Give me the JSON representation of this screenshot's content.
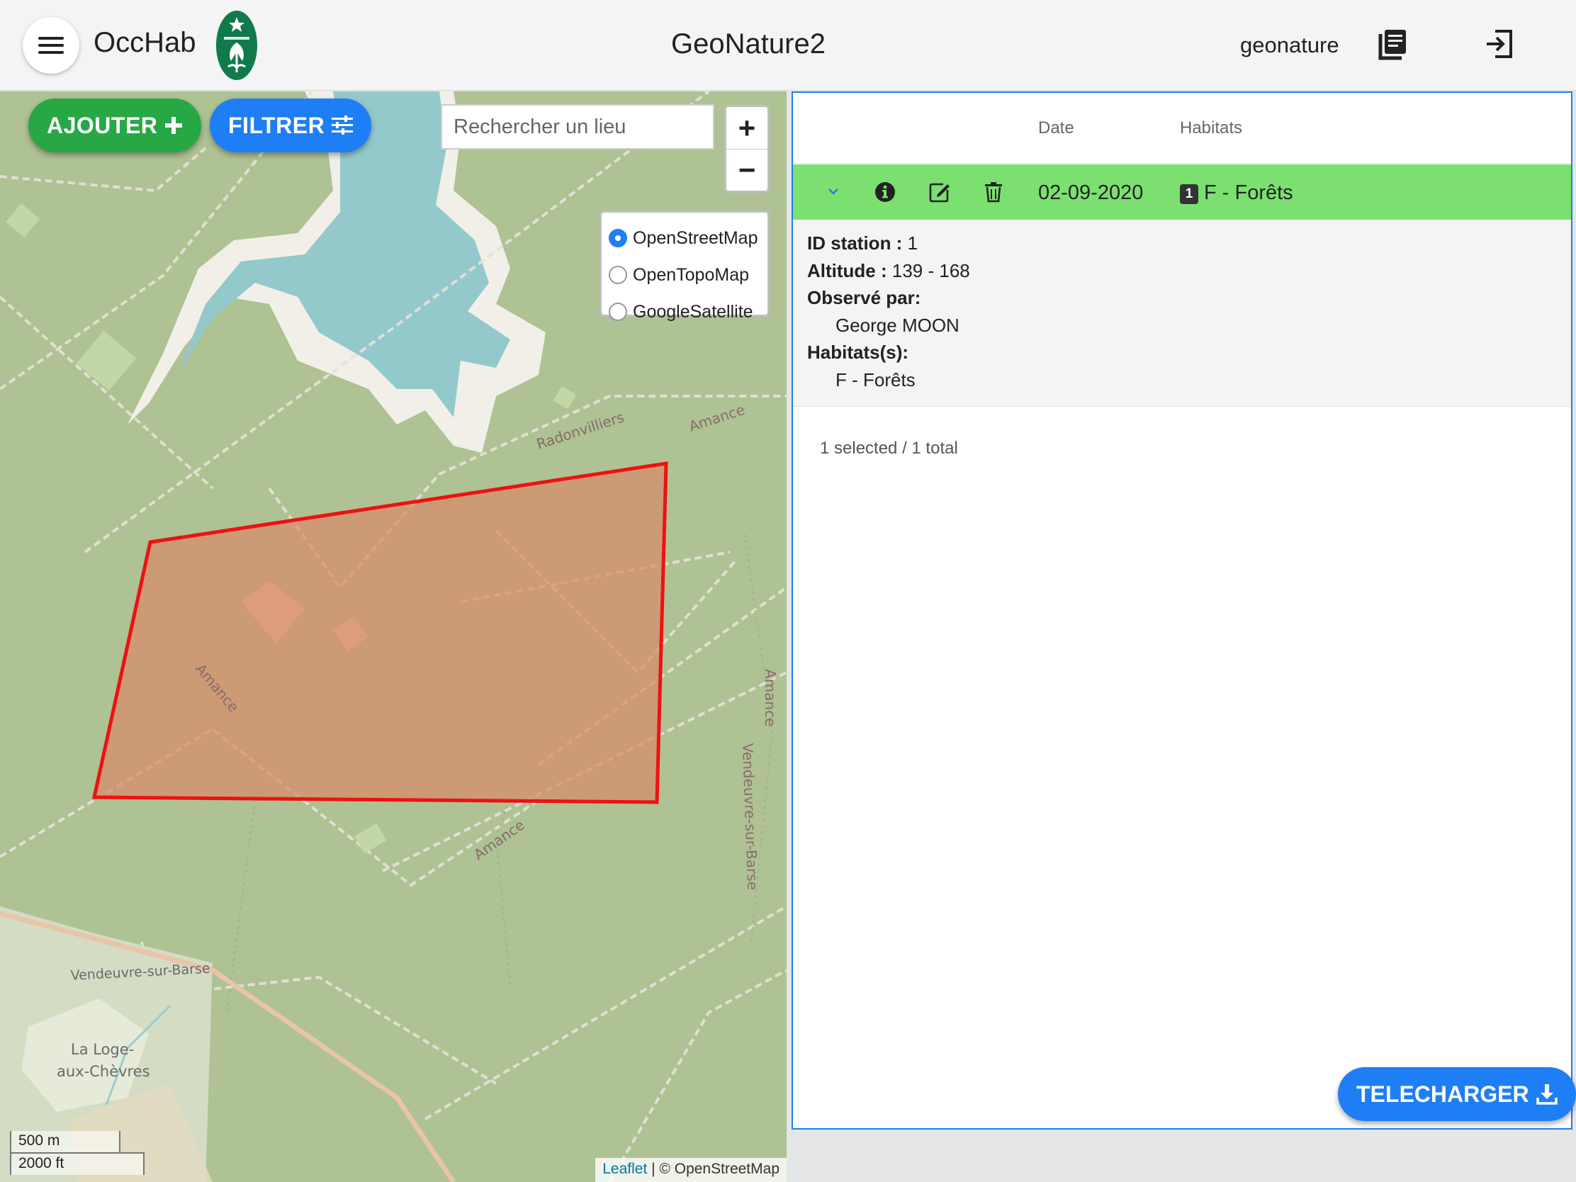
{
  "header": {
    "app_name": "OccHab",
    "center_title": "GeoNature2",
    "username": "geonature",
    "icons": {
      "menu": "hamburger-icon",
      "docs": "documentation-icon",
      "logout": "logout-icon"
    }
  },
  "map": {
    "add_button": "AJOUTER",
    "filter_button": "FILTRER",
    "search_placeholder": "Rechercher un lieu",
    "zoom_in": "+",
    "zoom_out": "−",
    "layers": [
      {
        "label": "OpenStreetMap",
        "checked": true
      },
      {
        "label": "OpenTopoMap",
        "checked": false
      },
      {
        "label": "GoogleSatellite",
        "checked": false
      }
    ],
    "labels": {
      "radonvilliers": "Radonvilliers",
      "amance_1": "Amance",
      "amance_2": "Amance",
      "amance_3": "Amance",
      "amance_4": "Amance",
      "vendeuvre_road": "Vendeuvre-sur-Barse",
      "vendeuvre_town": "Vendeuvre-sur-Barse",
      "la_loge": "La Loge-",
      "aux_chevres": "aux-Chèvres"
    },
    "scale_m": "500 m",
    "scale_ft": "2000 ft",
    "attribution_link": "Leaflet",
    "attribution_text": " | © OpenStreetMap",
    "colors": {
      "polygon_stroke": "#ee1111",
      "polygon_fill": "#d88a6a",
      "water": "#94c9cc",
      "forest": "#aec294"
    }
  },
  "table": {
    "columns": [
      "Date",
      "Habitats"
    ],
    "rows": [
      {
        "date": "02-09-2020",
        "habitat_count": "1",
        "habitat": "F - Forêts",
        "selected": true
      }
    ],
    "detail": {
      "id_label": "ID station :",
      "id_value": " 1",
      "altitude_label": "Altitude :",
      "altitude_value": " 139 - 168",
      "observer_label": "Observé par:",
      "observer_value": "George MOON",
      "habitats_label": "Habitats(s):",
      "habitats_value": "F - Forêts"
    },
    "footer": "1 selected / 1 total"
  },
  "download_button": "TELECHARGER",
  "colors": {
    "primary": "#1e7ef5",
    "success": "#28a745",
    "selected_row": "#7be070"
  }
}
